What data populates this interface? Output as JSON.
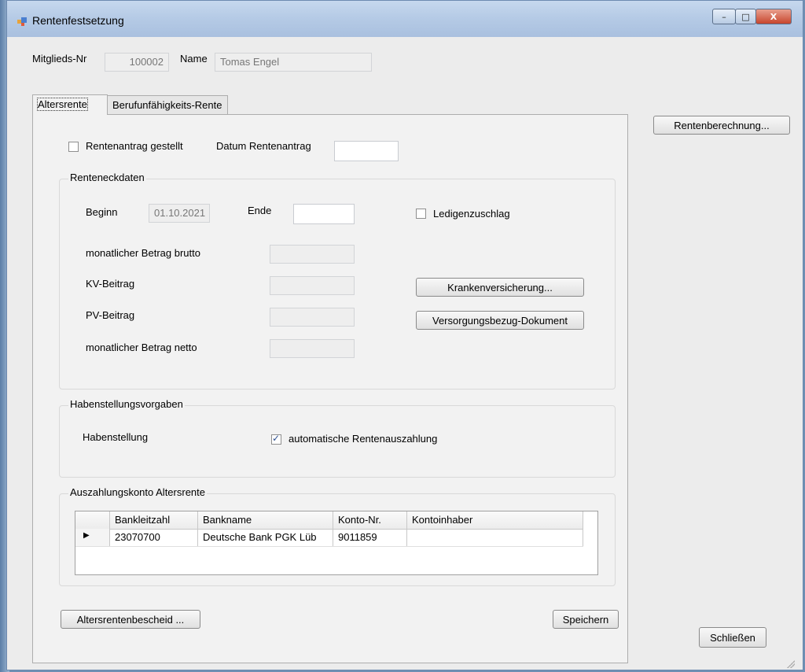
{
  "window": {
    "title": "Rentenfestsetzung",
    "controls": {
      "minimize": "–",
      "maximize": "□",
      "close": "X"
    }
  },
  "member": {
    "number_label": "Mitglieds-Nr",
    "number_value": "100002",
    "name_label": "Name",
    "name_value": "Tomas Engel"
  },
  "tabs": [
    {
      "label": "Altersrente",
      "active": true
    },
    {
      "label": "Berufunfähigkeits-Rente",
      "active": false
    }
  ],
  "side_buttons": {
    "rentenberechnung": "Rentenberechnung...",
    "schliessen": "Schließen"
  },
  "application": {
    "checkbox_label": "Rentenantrag gestellt",
    "checked": false,
    "date_label": "Datum Rentenantrag",
    "date_value": ""
  },
  "eckdaten": {
    "title": "Renteneckdaten",
    "begin_label": "Beginn",
    "begin_value": "01.10.2021",
    "end_label": "Ende",
    "end_value": "",
    "ledigen_label": "Ledigenzuschlag",
    "ledigen_checked": false,
    "brutto_label": "monatlicher Betrag brutto",
    "kv_label": "KV-Beitrag",
    "pv_label": "PV-Beitrag",
    "netto_label": "monatlicher Betrag netto",
    "krankenversicherung_button": "Krankenversicherung...",
    "versorgungsbezug_button": "Versorgungsbezug-Dokument"
  },
  "haben": {
    "title": "Habenstellungsvorgaben",
    "label": "Habenstellung",
    "auto_label": "automatische Rentenauszahlung",
    "auto_checked": true
  },
  "konto": {
    "title": "Auszahlungskonto Altersrente",
    "columns": [
      "",
      "Bankleitzahl",
      "Bankname",
      "Konto-Nr.",
      "Kontoinhaber"
    ],
    "rows": [
      {
        "indicator": "▶",
        "blz": "23070700",
        "bankname": "Deutsche Bank PGK Lüb",
        "konto": "9011859",
        "inhaber": ""
      }
    ]
  },
  "footer_buttons": {
    "bescheid": "Altersrentenbescheid ...",
    "speichern": "Speichern"
  },
  "colors": {
    "titlebar": "#b6cbe6",
    "close_button": "#c7452d",
    "checkmark": "#2d4f8f"
  }
}
